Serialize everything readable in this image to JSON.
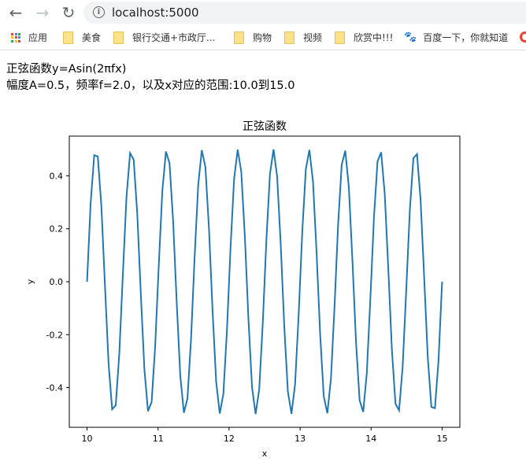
{
  "browser": {
    "url": "localhost:5000",
    "bookmarks": [
      {
        "label": "应用",
        "icon": "apps-grid-icon"
      },
      {
        "label": "美食",
        "icon": "folder-icon"
      },
      {
        "label": "银行交通+市政厅...",
        "icon": "folder-icon"
      },
      {
        "label": "购物",
        "icon": "folder-icon"
      },
      {
        "label": "视频",
        "icon": "folder-icon"
      },
      {
        "label": "欣赏中!!!",
        "icon": "folder-icon"
      },
      {
        "label": "百度一下，你就知道",
        "icon": "baidu-paw-icon"
      }
    ]
  },
  "page": {
    "line1": "正弦函数y=Asin(2πfx)",
    "line2": "幅度A=0.5，频率f=2.0，以及x对应的范围:10.0到15.0"
  },
  "chart_data": {
    "type": "line",
    "title": "正弦函数",
    "xlabel": "x",
    "ylabel": "y",
    "xlim": [
      9.75,
      15.25
    ],
    "ylim": [
      -0.55,
      0.55
    ],
    "x_range": [
      10,
      15
    ],
    "xticks": [
      "10",
      "11",
      "12",
      "13",
      "14",
      "15"
    ],
    "yticks": [
      "-0.4",
      "-0.2",
      "0.0",
      "0.2",
      "0.4"
    ],
    "grid": false,
    "line_color": "#1f77b4",
    "y": [
      0,
      0.297,
      0.478,
      0.473,
      0.284,
      -0.016,
      -0.309,
      -0.482,
      -0.467,
      -0.27,
      0.032,
      0.321,
      0.486,
      0.461,
      0.257,
      -0.048,
      -0.333,
      -0.489,
      -0.455,
      -0.243,
      0.063,
      0.345,
      0.492,
      0.448,
      0.229,
      -0.079,
      -0.356,
      -0.495,
      -0.441,
      -0.215,
      0.095,
      0.367,
      0.497,
      0.433,
      0.2,
      -0.11,
      -0.378,
      -0.498,
      -0.425,
      -0.186,
      0.126,
      0.388,
      0.499,
      0.416,
      0.171,
      -0.141,
      -0.398,
      -0.5,
      -0.407,
      -0.156,
      0.156,
      0.407,
      0.5,
      0.398,
      0.141,
      -0.171,
      -0.416,
      -0.499,
      -0.388,
      -0.126,
      0.186,
      0.425,
      0.498,
      0.378,
      0.11,
      -0.2,
      -0.433,
      -0.497,
      -0.367,
      -0.095,
      0.215,
      0.441,
      0.495,
      0.356,
      0.079,
      -0.229,
      -0.448,
      -0.492,
      -0.345,
      -0.063,
      0.243,
      0.455,
      0.489,
      0.333,
      0.048,
      -0.257,
      -0.461,
      -0.486,
      -0.321,
      -0.032,
      0.27,
      0.467,
      0.482,
      0.309,
      0.016,
      -0.284,
      -0.473,
      -0.478,
      -0.297,
      0
    ]
  }
}
